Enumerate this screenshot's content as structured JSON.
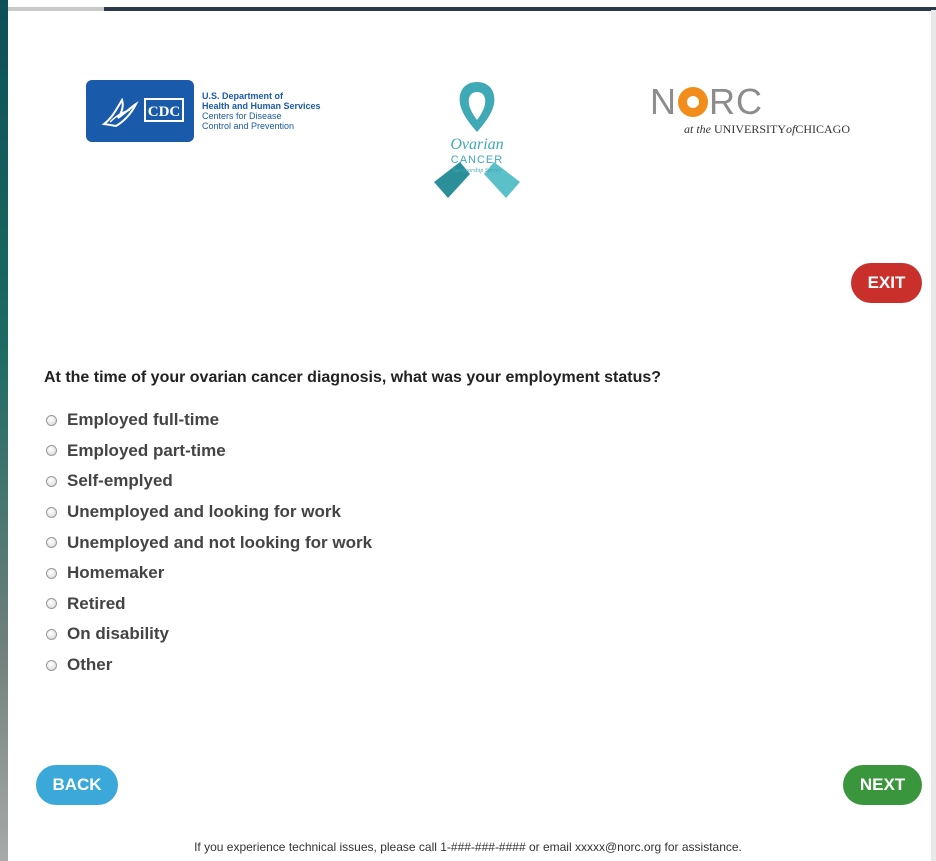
{
  "header": {
    "cdc": {
      "mark": "CDC",
      "line1": "U.S. Department of",
      "line2": "Health and Human Services",
      "line3": "Centers for Disease",
      "line4": "Control and Prevention"
    },
    "ribbon": {
      "line1": "Ovarian",
      "line2": "CANCER",
      "line3": "Survivorship Survey"
    },
    "norc": {
      "word_n": "N",
      "word_rc": "RC",
      "sub_at_the": "at the",
      "sub_university": "UNIVERSITY",
      "sub_of": "of",
      "sub_chicago": "CHICAGO"
    }
  },
  "exit_label": "EXIT",
  "question": "At the time of your ovarian cancer diagnosis, what was your employment status?",
  "options": [
    "Employed full-time",
    "Employed part-time",
    "Self-emplyed",
    "Unemployed and looking for work",
    "Unemployed and not looking for work",
    "Homemaker",
    "Retired",
    "On disability",
    "Other"
  ],
  "nav": {
    "back_label": "BACK",
    "next_label": "NEXT"
  },
  "footer": {
    "text_before": "If you experience technical issues, please call 1-###-###-#### or email ",
    "email": "xxxxx@norc.org",
    "text_after": " for assistance."
  },
  "colors": {
    "exit": "#c9302c",
    "back": "#3aa8d9",
    "next": "#3a963c",
    "cdc_blue": "#1a5aab",
    "ribbon_teal": "#3fa9b5",
    "norc_orange": "#f28c1a"
  }
}
